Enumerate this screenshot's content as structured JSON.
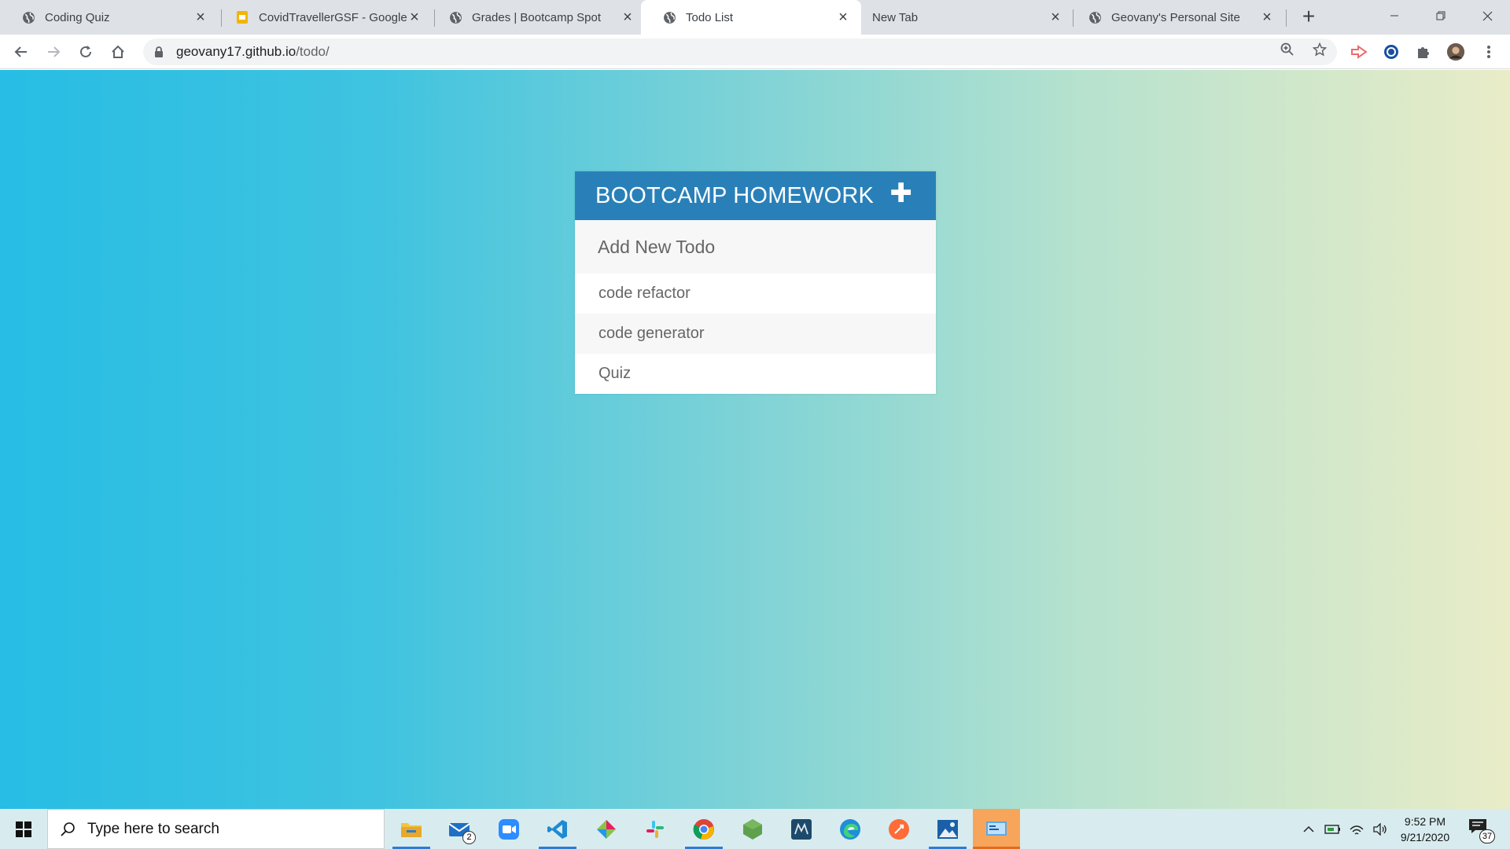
{
  "browser": {
    "tabs": [
      {
        "title": "Coding Quiz",
        "icon": "globe-icon",
        "active": false
      },
      {
        "title": "CovidTravellerGSF - Google",
        "icon": "slides-icon",
        "active": false
      },
      {
        "title": "Grades | Bootcamp Spot",
        "icon": "globe-icon",
        "active": false
      },
      {
        "title": "Todo List",
        "icon": "globe-icon",
        "active": true
      },
      {
        "title": "New Tab",
        "icon": "",
        "active": false
      },
      {
        "title": "Geovany's Personal Site",
        "icon": "globe-icon",
        "active": false
      }
    ],
    "address": {
      "host": "geovany17.github.io",
      "path": "/todo/"
    }
  },
  "todo": {
    "title": "BOOTCAMP HOMEWORK",
    "add_icon": "plus-icon",
    "input_placeholder": "Add New Todo",
    "items": [
      "code refactor",
      "code generator",
      "Quiz"
    ]
  },
  "taskbar": {
    "search_placeholder": "Type here to search",
    "mail_badge": "2",
    "time": "9:52 PM",
    "date": "9/21/2020",
    "notification_count": "37"
  },
  "colors": {
    "header": "#2980b9",
    "gradient_start": "#27bde4",
    "gradient_end": "#e9ecc7"
  }
}
